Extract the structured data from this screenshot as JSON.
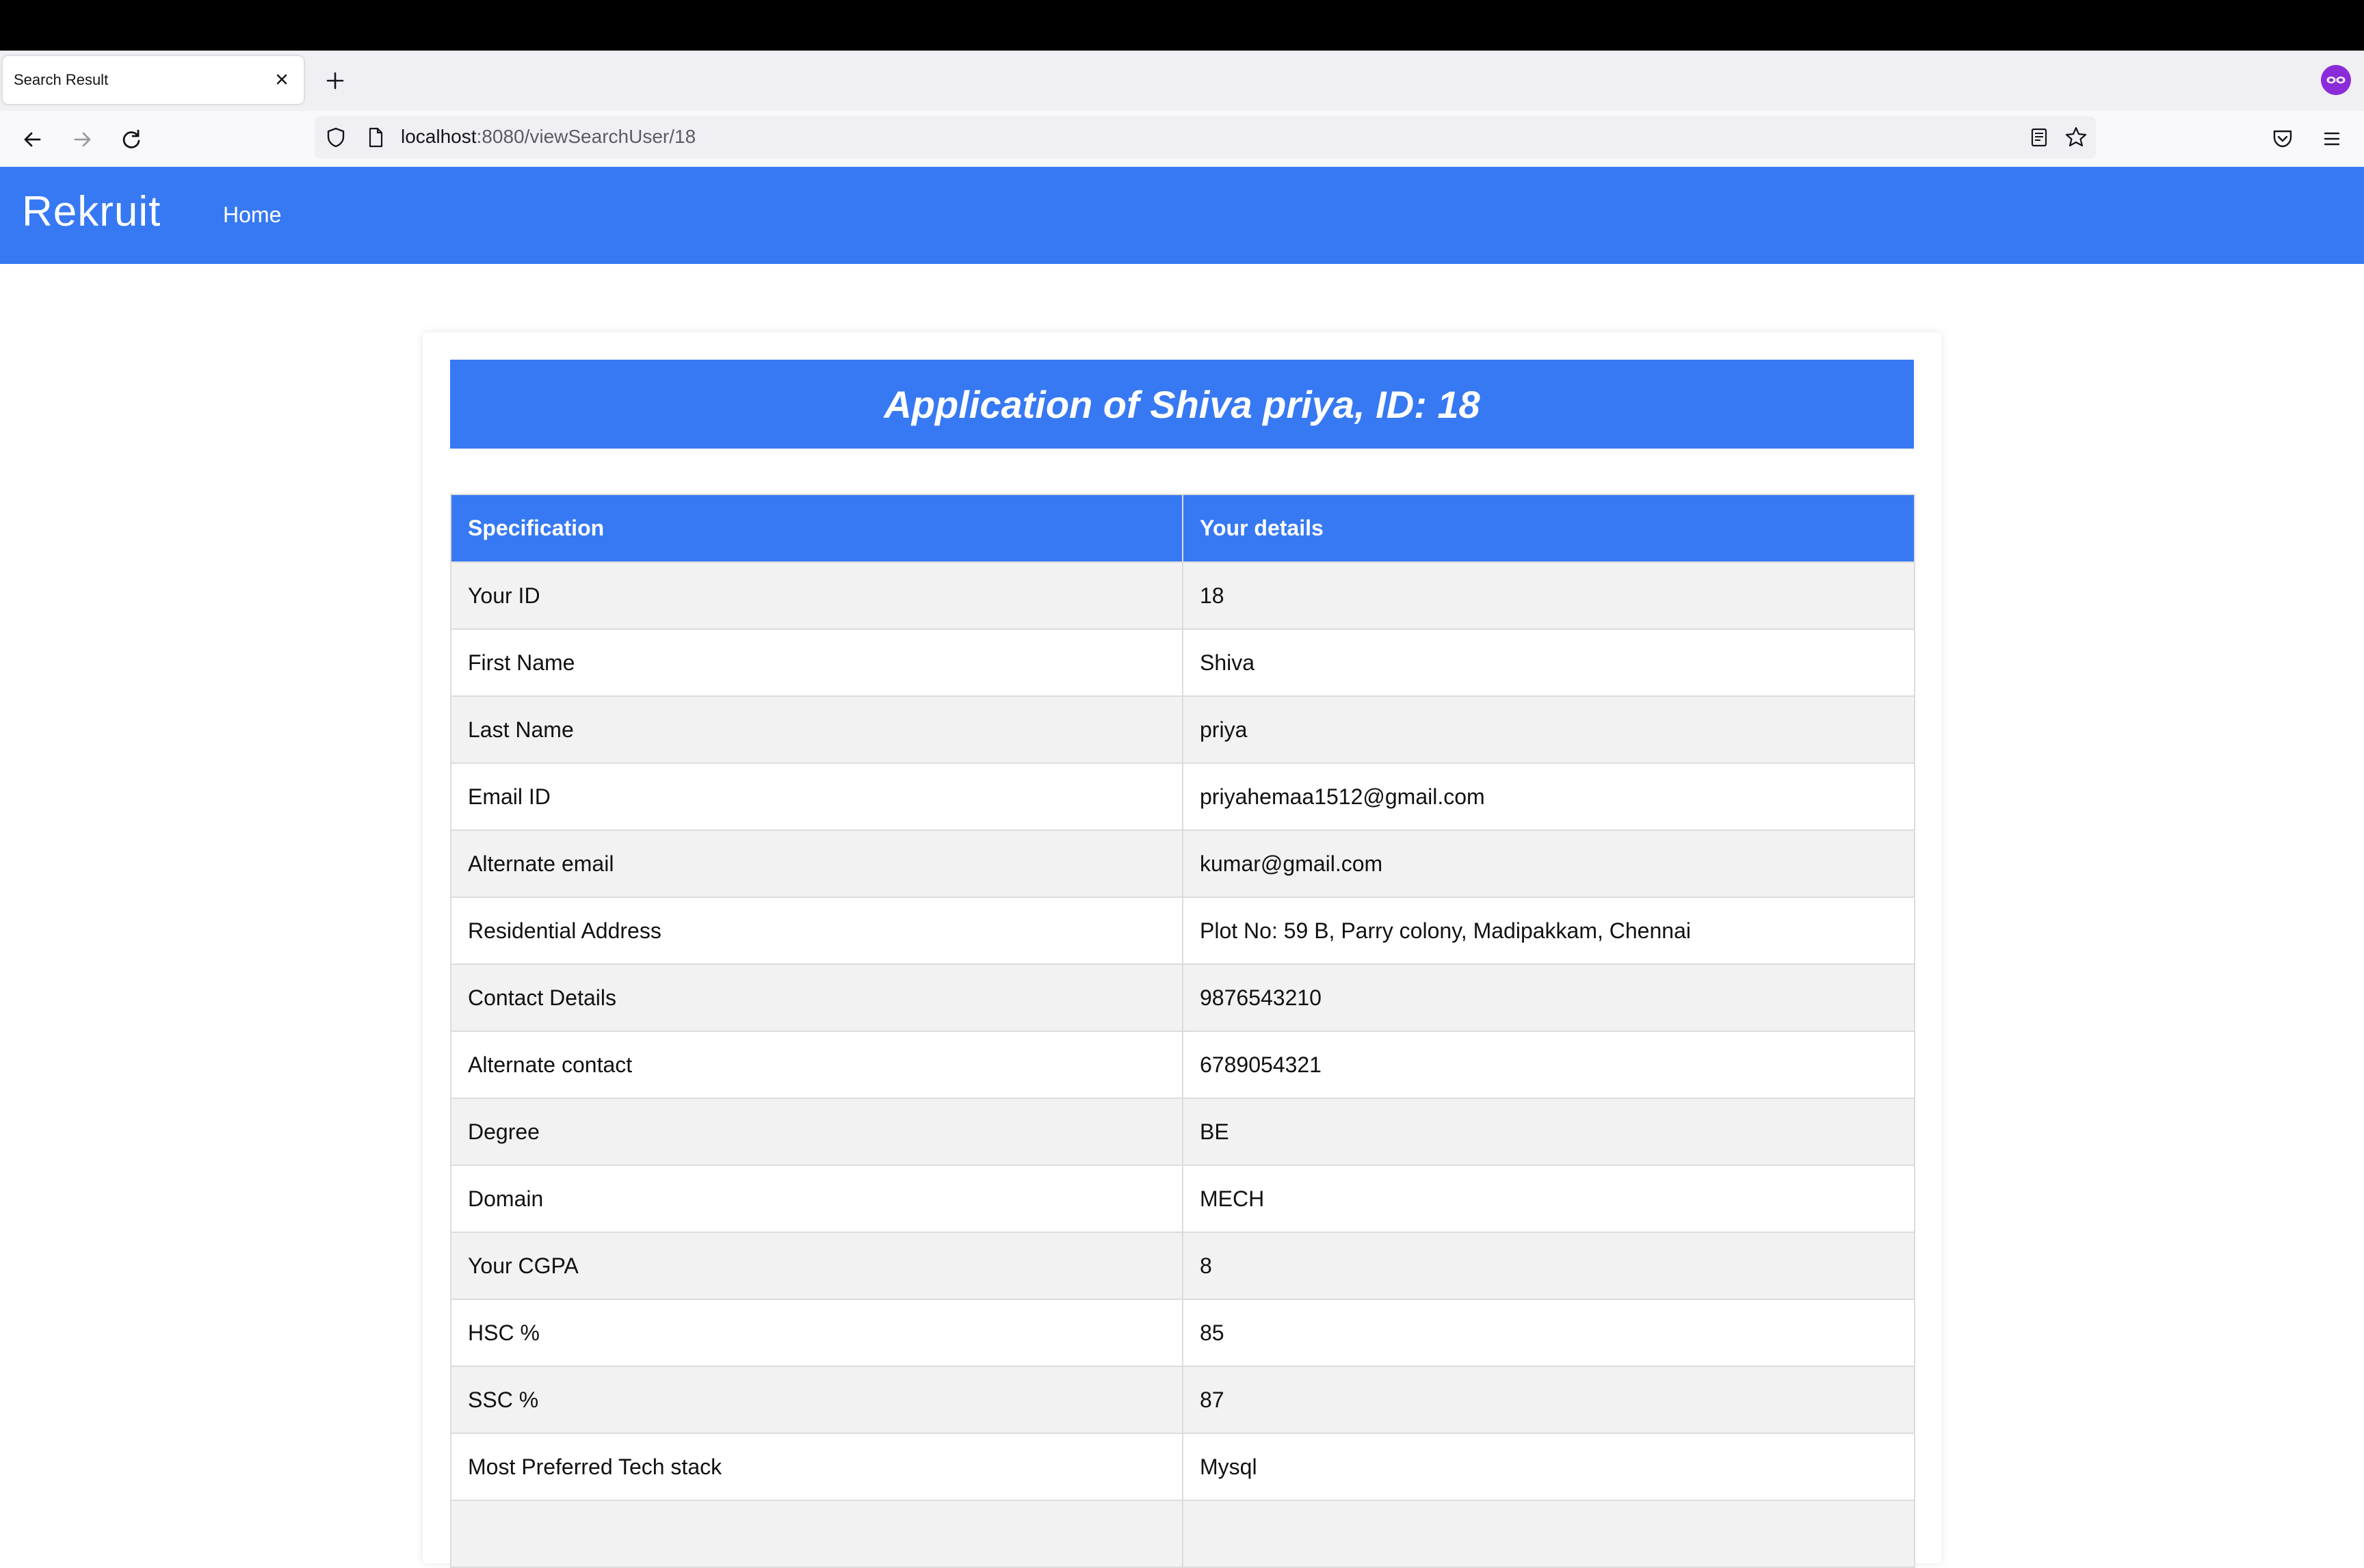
{
  "browser": {
    "tab_title": "Search Result",
    "url_host": "localhost",
    "url_path": ":8080/viewSearchUser/18"
  },
  "app": {
    "brand": "Rekruit",
    "nav_home": "Home",
    "accent_color": "#3779f3"
  },
  "card": {
    "title": "Application of Shiva priya, ID: 18"
  },
  "table": {
    "headers": [
      "Specification",
      "Your details"
    ],
    "rows": [
      [
        "Your ID",
        "18"
      ],
      [
        "First Name",
        "Shiva"
      ],
      [
        "Last Name",
        "priya"
      ],
      [
        "Email ID",
        "priyahemaa1512@gmail.com"
      ],
      [
        "Alternate email",
        "kumar@gmail.com"
      ],
      [
        "Residential Address",
        "Plot No: 59 B, Parry colony, Madipakkam, Chennai"
      ],
      [
        "Contact Details",
        "9876543210"
      ],
      [
        "Alternate contact",
        "6789054321"
      ],
      [
        "Degree",
        "BE"
      ],
      [
        "Domain",
        "MECH"
      ],
      [
        "Your CGPA",
        "8"
      ],
      [
        "HSC %",
        "85"
      ],
      [
        "SSC %",
        "87"
      ],
      [
        "Most Preferred Tech stack",
        "Mysql"
      ]
    ]
  },
  "icons": {
    "tab_close": "close-icon",
    "new_tab": "plus-icon",
    "profile": "private-browsing-icon",
    "back": "back-arrow-icon",
    "forward": "forward-arrow-icon",
    "reload": "reload-icon",
    "shield": "shield-icon",
    "page": "page-icon",
    "reader": "reader-view-icon",
    "bookmark": "star-icon",
    "pocket": "pocket-icon",
    "menu": "hamburger-menu-icon"
  }
}
